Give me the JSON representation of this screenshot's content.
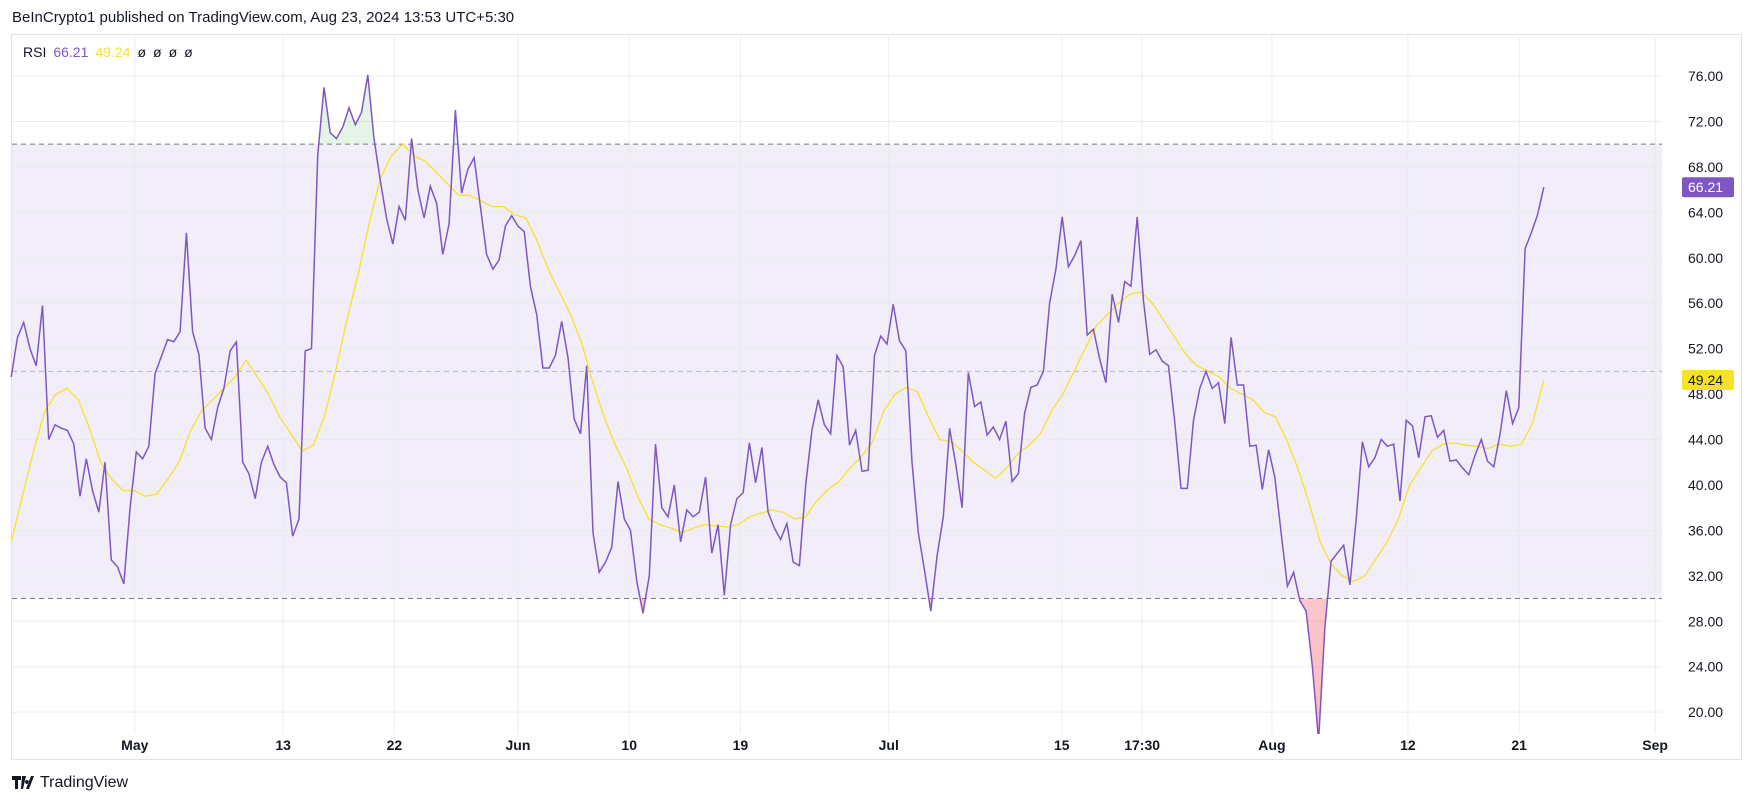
{
  "header": {
    "published": "BeInCrypto1 published on TradingView.com, Aug 23, 2024 13:53 UTC+5:30"
  },
  "legend": {
    "name": "RSI",
    "rsi_value": "66.21",
    "ma_value": "49.24",
    "na": [
      "ø",
      "ø",
      "ø",
      "ø"
    ]
  },
  "footer": {
    "brand": "TradingView"
  },
  "colors": {
    "rsi": "#7e57c2",
    "ma": "#f5e12a",
    "band": "#7e57c2",
    "grid": "#f0f3fa"
  },
  "chart_data": {
    "type": "line",
    "title": "RSI",
    "x_start": "2024-04-21",
    "x_end": "2024-08-23",
    "x_unit": "days since 2024-04-21",
    "x_range_days": [
      0,
      135
    ],
    "ylim": [
      18.3,
      79.7
    ],
    "y_ticks": [
      "76.00",
      "72.00",
      "68.00",
      "64.00",
      "60.00",
      "56.00",
      "52.00",
      "48.00",
      "44.00",
      "40.00",
      "36.00",
      "32.00",
      "28.00",
      "24.00",
      "20.00"
    ],
    "y_tick_values": [
      76,
      72,
      68,
      64,
      60,
      56,
      52,
      48,
      44,
      40,
      36,
      32,
      28,
      24,
      20
    ],
    "x_ticks": [
      {
        "label": "May",
        "day": 10
      },
      {
        "label": "13",
        "day": 22
      },
      {
        "label": "22",
        "day": 31
      },
      {
        "label": "Jun",
        "day": 41
      },
      {
        "label": "10",
        "day": 50
      },
      {
        "label": "19",
        "day": 59
      },
      {
        "label": "Jul",
        "day": 71
      },
      {
        "label": "15",
        "day": 85
      },
      {
        "label": "17:30",
        "day": 91.5
      },
      {
        "label": "Aug",
        "day": 102
      },
      {
        "label": "12",
        "day": 113
      },
      {
        "label": "21",
        "day": 122
      },
      {
        "label": "Sep",
        "day": 133
      }
    ],
    "bands": {
      "upper": 70,
      "middle": 50,
      "lower": 30
    },
    "last_labels": {
      "rsi": "66.21",
      "ma": "49.24"
    },
    "grid": true,
    "series": [
      {
        "name": "RSI",
        "values": [
          49.5,
          53,
          54.3,
          52,
          50.5,
          55.8,
          44,
          45.3,
          45,
          44.8,
          43.6,
          39,
          42.3,
          39.5,
          37.6,
          42,
          33.4,
          32.8,
          31.3,
          38,
          42.9,
          42.3,
          43.4,
          49.8,
          51.3,
          52.8,
          52.6,
          53.5,
          62.2,
          53.5,
          51.5,
          45,
          44,
          46.8,
          48.5,
          51.8,
          52.6,
          42,
          41,
          38.8,
          42,
          43.4,
          41.8,
          40.7,
          40.2,
          35.5,
          37,
          51.8,
          52,
          69,
          75,
          71,
          70.5,
          71.5,
          73.2,
          71.7,
          72.8,
          76.1,
          70.5,
          66.8,
          63.5,
          61.2,
          64.5,
          63.3,
          70.5,
          66,
          63.5,
          66.3,
          64.8,
          60.3,
          63,
          73,
          65.7,
          67.8,
          68.8,
          64.5,
          60.3,
          59,
          59.8,
          62.8,
          63.7,
          62.8,
          62.3,
          57.5,
          55,
          50.3,
          50.3,
          51.4,
          54.4,
          51.2,
          45.8,
          44.5,
          50.5,
          35.8,
          32.3,
          33.2,
          34.5,
          40.3,
          37,
          36,
          31.5,
          28.7,
          32,
          43.6,
          38,
          37.2,
          40,
          35,
          37.8,
          37.2,
          37.6,
          40.7,
          34,
          36.5,
          30.3,
          36.5,
          38.8,
          39.3,
          43.7,
          40.2,
          43.3,
          37.6,
          36.2,
          35.2,
          36.6,
          33.2,
          32.9,
          40,
          44.8,
          47.5,
          45.3,
          44.5,
          51.4,
          50.4,
          43.5,
          44.8,
          41.2,
          41.3,
          51.4,
          53.1,
          52.4,
          55.9,
          52.7,
          51.8,
          42,
          35.8,
          32.5,
          28.9,
          33.7,
          37.2,
          45,
          41.8,
          38,
          49.9,
          46.9,
          47.3,
          44.4,
          45.1,
          44,
          45.6,
          40.3,
          41,
          46.3,
          48.6,
          48.8,
          50,
          56,
          59,
          63.6,
          59.2,
          60.2,
          61.5,
          53.2,
          53.7,
          51.1,
          49,
          56.8,
          54.3,
          57.9,
          57.5,
          63.6,
          56.2,
          51.5,
          51.9,
          50.9,
          50.5,
          45.5,
          39.7,
          39.7,
          45.7,
          48.5,
          50,
          48.5,
          49,
          45.4,
          53,
          48.8,
          48.8,
          43.4,
          43.5,
          39.6,
          43.1,
          40.7,
          35.8,
          31.1,
          32.3,
          29.8,
          28.9,
          24,
          17.5,
          27.5,
          33.3,
          34,
          34.7,
          31.2,
          37,
          43.8,
          41.6,
          42.4,
          44,
          43.4,
          43.6,
          38.6,
          45.7,
          45.2,
          42.4,
          46,
          46.1,
          44.2,
          44.8,
          42.1,
          42.2,
          41.5,
          40.9,
          42.6,
          44,
          42.1,
          41.6,
          44.5,
          48.3,
          45.4,
          46.8,
          60.8,
          62.2,
          63.8,
          66.21
        ]
      },
      {
        "name": "RSI-based MA",
        "values": [
          35,
          39,
          43,
          46.5,
          48,
          48.5,
          47.5,
          45,
          42,
          40.5,
          39.5,
          39.5,
          39,
          39.2,
          40.5,
          42,
          44.7,
          46.5,
          47.5,
          48.5,
          49.5,
          51,
          49.5,
          48,
          46,
          44.5,
          43,
          43.5,
          46,
          50,
          54.5,
          58.5,
          63,
          67,
          69,
          70,
          69,
          68.5,
          67.5,
          66.5,
          65.5,
          65.5,
          65,
          64.5,
          64.5,
          63.8,
          63.5,
          61.5,
          59,
          57,
          55,
          52.5,
          49,
          46,
          43.5,
          41.5,
          39,
          37,
          36.5,
          36.2,
          35.8,
          36.2,
          36.5,
          36.4,
          36.3,
          36.5,
          37.2,
          37.5,
          37.8,
          37.6,
          37,
          37.2,
          38.6,
          39.6,
          40.3,
          41.5,
          42.5,
          43.8,
          46.5,
          48,
          48.6,
          48.2,
          46,
          44,
          43.8,
          43,
          42,
          41.3,
          40.6,
          41.5,
          42.8,
          43.5,
          44.5,
          46.5,
          48,
          50,
          52,
          54,
          55,
          56,
          56.8,
          57,
          56,
          54.5,
          53,
          51.5,
          50.5,
          50,
          49.5,
          48.5,
          48,
          47.5,
          46.4,
          46,
          44,
          41.5,
          38.5,
          35,
          33,
          32,
          31.5,
          32,
          33.5,
          35,
          37,
          40,
          41.5,
          43,
          43.6,
          43.7,
          43.5,
          43.4,
          43.2,
          43.6,
          43.4,
          43.6,
          45.5,
          49.24
        ]
      }
    ]
  }
}
